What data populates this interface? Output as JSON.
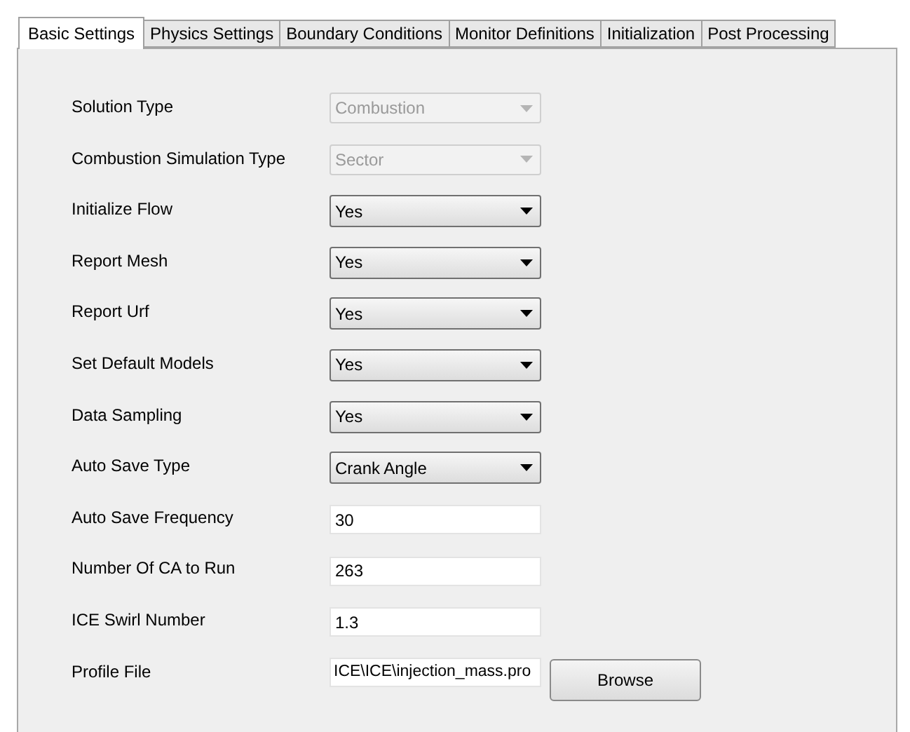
{
  "tabs": [
    {
      "label": "Basic Settings",
      "selected": true
    },
    {
      "label": "Physics Settings",
      "selected": false
    },
    {
      "label": "Boundary Conditions",
      "selected": false
    },
    {
      "label": "Monitor Definitions",
      "selected": false
    },
    {
      "label": "Initialization",
      "selected": false
    },
    {
      "label": "Post Processing",
      "selected": false
    }
  ],
  "fields": [
    {
      "label": "Solution Type",
      "kind": "dropdown",
      "value": "Combustion",
      "disabled": true
    },
    {
      "label": "Combustion Simulation Type",
      "kind": "dropdown",
      "value": "Sector",
      "disabled": true
    },
    {
      "label": "Initialize Flow",
      "kind": "dropdown",
      "value": "Yes",
      "disabled": false
    },
    {
      "label": "Report Mesh",
      "kind": "dropdown",
      "value": "Yes",
      "disabled": false
    },
    {
      "label": "Report Urf",
      "kind": "dropdown",
      "value": "Yes",
      "disabled": false
    },
    {
      "label": "Set Default Models",
      "kind": "dropdown",
      "value": "Yes",
      "disabled": false
    },
    {
      "label": "Data Sampling",
      "kind": "dropdown",
      "value": "Yes",
      "disabled": false
    },
    {
      "label": "Auto Save Type",
      "kind": "dropdown",
      "value": "Crank Angle",
      "disabled": false
    },
    {
      "label": "Auto Save Frequency",
      "kind": "text",
      "value": "30"
    },
    {
      "label": "Number Of CA to Run",
      "kind": "text",
      "value": "263"
    },
    {
      "label": "ICE Swirl Number",
      "kind": "text",
      "value": "1.3"
    },
    {
      "label": "Profile File",
      "kind": "file",
      "value": "ICE\\ICE\\injection_mass.pro",
      "button": "Browse"
    }
  ]
}
